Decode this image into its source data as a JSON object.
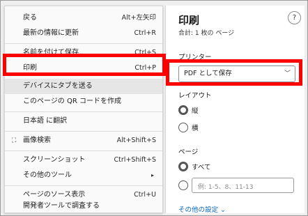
{
  "context_menu": {
    "items": [
      {
        "label": "戻る",
        "shortcut": "Alt+左矢印"
      },
      {
        "label": "最新の情報に更新",
        "shortcut": "Ctrl+R"
      },
      {
        "label": "名前を付けて保存",
        "shortcut": "Ctrl+S"
      },
      {
        "label": "印刷",
        "shortcut": "Ctrl+P"
      },
      {
        "label": "デバイスにタブを送る",
        "shortcut": ""
      },
      {
        "label": "このページの QR コードを作成",
        "shortcut": ""
      },
      {
        "label": "日本語 に翻訳",
        "shortcut": ""
      },
      {
        "label": "画像検索",
        "shortcut": "Alt+Shift+S"
      },
      {
        "label": "スクリーンショット",
        "shortcut": "Ctrl+Shift+S"
      },
      {
        "label": "その他のツール",
        "shortcut": "▸"
      },
      {
        "label": "ページのソース表示",
        "shortcut": "Ctrl+U"
      },
      {
        "label": "開発者ツールで調査する",
        "shortcut": ""
      }
    ]
  },
  "print_panel": {
    "title": "印刷",
    "subtitle": "合計: 1 枚の ページ",
    "help_label": "?",
    "printer_label": "プリンター",
    "printer_value": "PDF として保存",
    "layout_label": "レイアウト",
    "layout_options": [
      "縦",
      "横"
    ],
    "pages_label": "ページ",
    "pages_options": [
      "すべて"
    ],
    "pages_placeholder": "例: 1-5、8、11-13",
    "more_settings": "その他の設定 ⌄"
  }
}
